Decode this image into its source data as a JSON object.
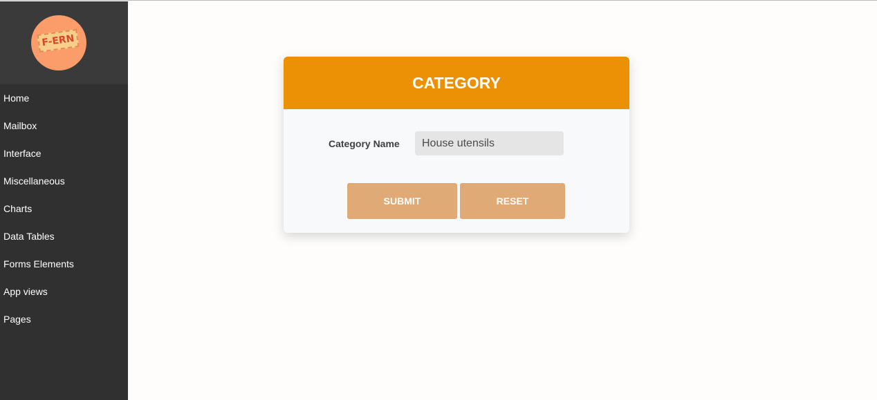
{
  "logo": {
    "text": "F-ERN",
    "colors": {
      "circle": "#fb9d6b",
      "tag": "#f7cf8a",
      "text": "#d9452a"
    }
  },
  "sidebar": {
    "items": [
      {
        "label": "Home"
      },
      {
        "label": "Mailbox"
      },
      {
        "label": "Interface"
      },
      {
        "label": "Miscellaneous"
      },
      {
        "label": "Charts"
      },
      {
        "label": "Data Tables"
      },
      {
        "label": "Forms Elements"
      },
      {
        "label": "App views"
      },
      {
        "label": "Pages"
      }
    ]
  },
  "form": {
    "title": "CATEGORY",
    "field_label": "Category Name",
    "field_value": "House utensils",
    "submit_label": "SUBMIT",
    "reset_label": "RESET"
  },
  "colors": {
    "sidebar_bg": "#303030",
    "header_accent": "#ec9106",
    "button_bg": "#e0aa77"
  }
}
